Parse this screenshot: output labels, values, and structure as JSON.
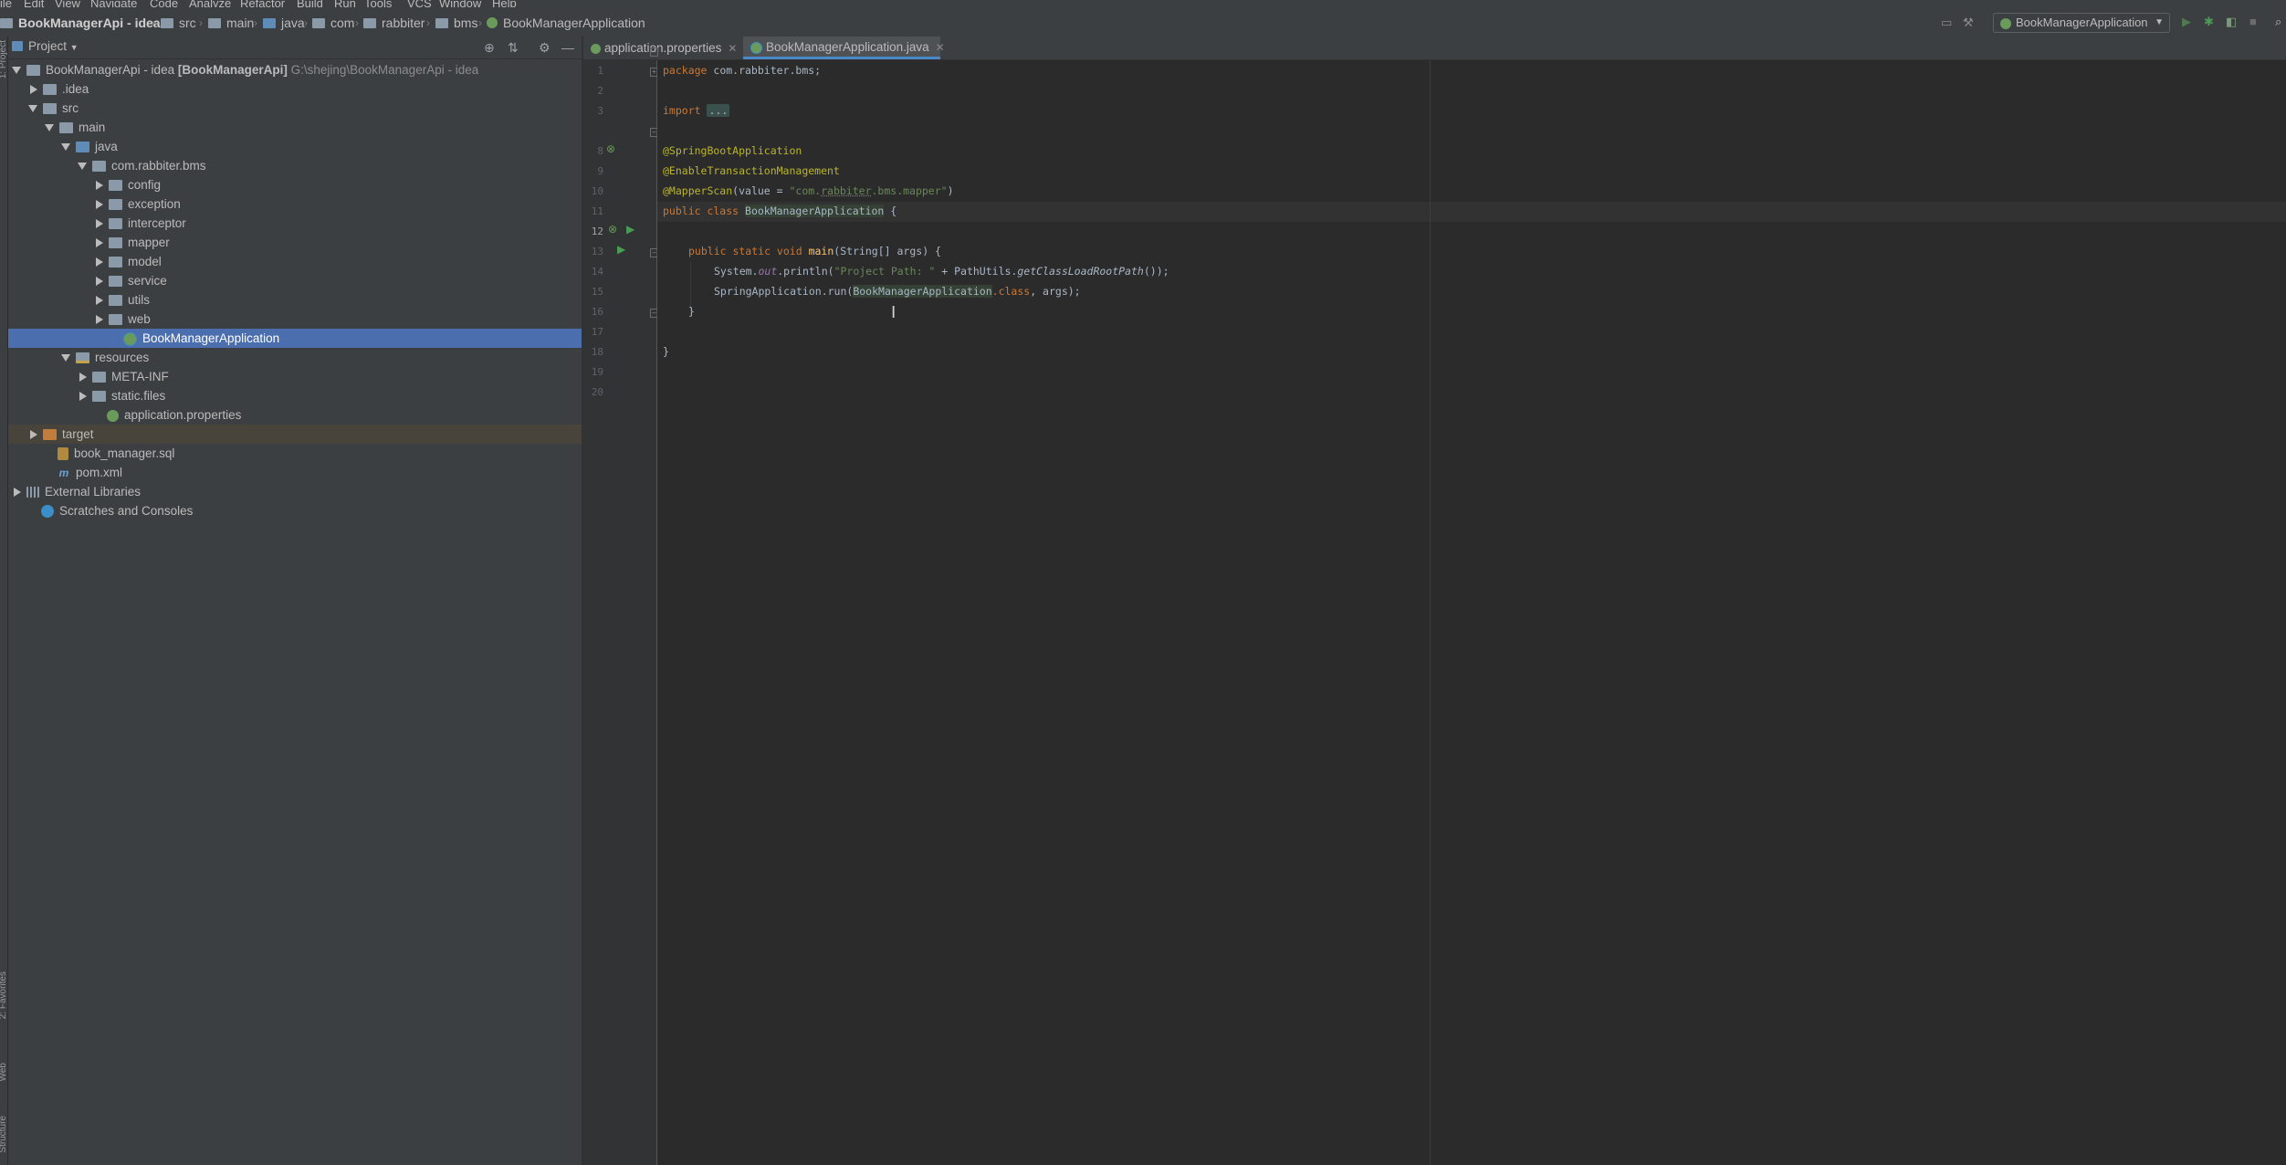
{
  "menu": [
    "ile",
    "Edit",
    "View",
    "Navigate",
    "Code",
    "Analyze",
    "Refactor",
    "Build",
    "Run",
    "Tools",
    "VCS",
    "Window",
    "Help"
  ],
  "breadcrumbs": [
    "BookManagerApi - idea",
    "src",
    "main",
    "java",
    "com",
    "rabbiter",
    "bms",
    "BookManagerApplication"
  ],
  "run_config": "BookManagerApplication",
  "left_stripe": {
    "project": "1: Project",
    "favorites": "2: Favorites",
    "web": "Web",
    "structure": "Structure"
  },
  "project_panel": {
    "title": "Project",
    "tree": [
      {
        "label": "BookManagerApi - idea",
        "suffix": "[BookManagerApi]",
        "path": "G:\\shejing\\BookManagerApi - idea",
        "depth": 0,
        "state": "open",
        "icon": "folder"
      },
      {
        "label": ".idea",
        "depth": 1,
        "state": "closed",
        "icon": "folder"
      },
      {
        "label": "src",
        "depth": 1,
        "state": "open",
        "icon": "folder"
      },
      {
        "label": "main",
        "depth": 2,
        "state": "open",
        "icon": "folder"
      },
      {
        "label": "java",
        "depth": 3,
        "state": "open",
        "icon": "folder-blue"
      },
      {
        "label": "com.rabbiter.bms",
        "depth": 4,
        "state": "open",
        "icon": "pkg"
      },
      {
        "label": "config",
        "depth": 5,
        "state": "closed",
        "icon": "pkg"
      },
      {
        "label": "exception",
        "depth": 5,
        "state": "closed",
        "icon": "pkg"
      },
      {
        "label": "interceptor",
        "depth": 5,
        "state": "closed",
        "icon": "pkg"
      },
      {
        "label": "mapper",
        "depth": 5,
        "state": "closed",
        "icon": "pkg"
      },
      {
        "label": "model",
        "depth": 5,
        "state": "closed",
        "icon": "pkg"
      },
      {
        "label": "service",
        "depth": 5,
        "state": "closed",
        "icon": "pkg"
      },
      {
        "label": "utils",
        "depth": 5,
        "state": "closed",
        "icon": "pkg"
      },
      {
        "label": "web",
        "depth": 5,
        "state": "closed",
        "icon": "pkg"
      },
      {
        "label": "BookManagerApplication",
        "depth": 6,
        "state": "none",
        "icon": "spring",
        "selected": true
      },
      {
        "label": "resources",
        "depth": 3,
        "state": "open",
        "icon": "folder-res"
      },
      {
        "label": "META-INF",
        "depth": 4,
        "state": "closed",
        "icon": "folder"
      },
      {
        "label": "static.files",
        "depth": 4,
        "state": "closed",
        "icon": "folder"
      },
      {
        "label": "application.properties",
        "depth": 5,
        "state": "none",
        "icon": "props"
      },
      {
        "label": "target",
        "depth": 1,
        "state": "closed",
        "icon": "folder-orange",
        "target": true
      },
      {
        "label": "book_manager.sql",
        "depth": 2,
        "state": "none",
        "icon": "sql"
      },
      {
        "label": "pom.xml",
        "depth": 2,
        "state": "none",
        "icon": "maven"
      },
      {
        "label": "External Libraries",
        "depth": 0,
        "state": "closed",
        "icon": "libs"
      },
      {
        "label": "Scratches and Consoles",
        "depth": 1,
        "state": "none",
        "icon": "scratch"
      }
    ]
  },
  "tabs": [
    {
      "label": "application.properties",
      "active": false
    },
    {
      "label": "BookManagerApplication.java",
      "active": true
    }
  ],
  "line_numbers": [
    "1",
    "2",
    "3",
    "8",
    "9",
    "10",
    "11",
    "12",
    "13",
    "14",
    "15",
    "16",
    "17",
    "18",
    "19",
    "20"
  ],
  "current_line": "12",
  "code": {
    "l1_kw": "package",
    "l1_rest": " com.rabbiter.bms;",
    "l3_kw": "import",
    "l3_fold": "...",
    "l9": "@SpringBootApplication",
    "l10": "@EnableTransactionManagement",
    "l11_ann": "@MapperScan",
    "l11_a": "(value = ",
    "l11_str1": "\"com.",
    "l11_str2": "rabbiter",
    "l11_str3": ".bms.mapper\"",
    "l11_b": ")",
    "l12_kw": "public class ",
    "l12_cls": "BookManagerApplication",
    "l12_b": " {",
    "l14_kw": "public static void ",
    "l14_fn": "main",
    "l14_rest": "(String[] args) {",
    "l15_a": "System.",
    "l15_fld": "out",
    "l15_b": ".println(",
    "l15_str": "\"Project Path: \"",
    "l15_c": " + PathUtils.",
    "l15_it": "getClassLoadRootPath",
    "l15_d": "());",
    "l16_a": "SpringApplication.",
    "l16_b": "run(",
    "l16_hl": "BookManagerApplication",
    "l16_kw": ".class",
    "l16_c": ", args);",
    "l17": "}",
    "l19": "}"
  }
}
